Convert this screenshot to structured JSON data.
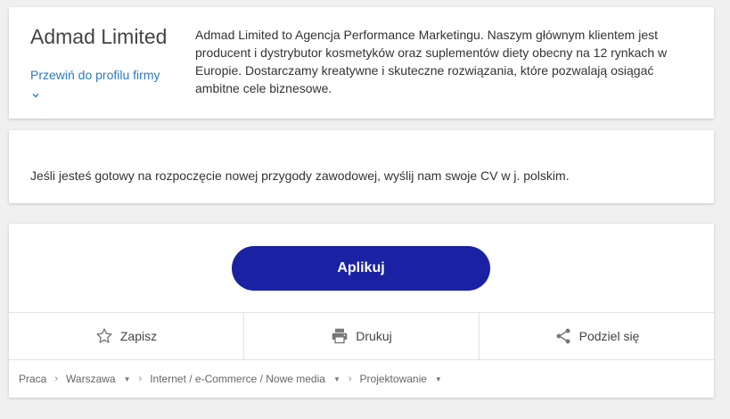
{
  "company": {
    "name": "Admad Limited",
    "profile_link": "Przewiń do profilu firmy",
    "description": "Admad Limited to Agencja Performance Marketingu. Naszym głównym klientem jest producent i dystrybutor kosmetyków oraz suplementów diety obecny na 12 rynkach w Europie. Dostarczamy kreatywne i skuteczne rozwiązania, które pozwalają osiągać ambitne cele biznesowe."
  },
  "cta": {
    "text": "Jeśli jesteś gotowy na rozpoczęcie nowej przygody zawodowej, wyślij nam swoje CV w j. polskim."
  },
  "apply": {
    "button_label": "Aplikuj",
    "actions": [
      {
        "label": "Zapisz",
        "icon": "star-icon"
      },
      {
        "label": "Drukuj",
        "icon": "printer-icon"
      },
      {
        "label": "Podziel się",
        "icon": "share-icon"
      }
    ]
  },
  "breadcrumb": [
    "Praca",
    "Warszawa",
    "Internet / e-Commerce / Nowe media",
    "Projektowanie"
  ],
  "colors": {
    "accent": "#1a22a3",
    "link": "#2a7bbf",
    "background": "#f0f0f0"
  }
}
